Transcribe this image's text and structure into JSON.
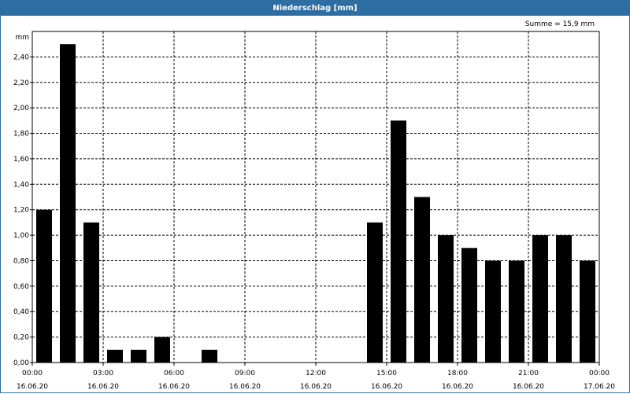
{
  "window": {
    "title": "Niederschlag [mm]"
  },
  "summary": {
    "label": "Summe = 15,9 mm"
  },
  "colors": {
    "titlebar": "#2f6ea3",
    "bar": "#000000",
    "grid": "#000000"
  },
  "chart_data": {
    "type": "bar",
    "title": "Niederschlag [mm]",
    "ylabel": "mm",
    "ylim": [
      0,
      2.6
    ],
    "grid": true,
    "y_ticks": [
      "0,00",
      "0,20",
      "0,40",
      "0,60",
      "0,80",
      "1,00",
      "1,20",
      "1,40",
      "1,60",
      "1,80",
      "2,00",
      "2,20",
      "2,40"
    ],
    "x_ticks": [
      {
        "time": "00:00",
        "date": "16.06.20"
      },
      {
        "time": "03:00",
        "date": "16.06.20"
      },
      {
        "time": "06:00",
        "date": "16.06.20"
      },
      {
        "time": "09:00",
        "date": "16.06.20"
      },
      {
        "time": "12:00",
        "date": "16.06.20"
      },
      {
        "time": "15:00",
        "date": "16.06.20"
      },
      {
        "time": "18:00",
        "date": "16.06.20"
      },
      {
        "time": "21:00",
        "date": "16.06.20"
      },
      {
        "time": "00:00",
        "date": "17.06.20"
      }
    ],
    "categories": [
      "00:00",
      "01:00",
      "02:00",
      "03:00",
      "04:00",
      "05:00",
      "06:00",
      "07:00",
      "08:00",
      "09:00",
      "10:00",
      "11:00",
      "12:00",
      "13:00",
      "14:00",
      "15:00",
      "16:00",
      "17:00",
      "18:00",
      "19:00",
      "20:00",
      "21:00",
      "22:00",
      "23:00"
    ],
    "values": [
      1.2,
      2.5,
      1.1,
      0.1,
      0.1,
      0.2,
      0.0,
      0.1,
      0.0,
      0.0,
      0.0,
      0.0,
      0.0,
      0.0,
      1.1,
      1.9,
      1.3,
      1.0,
      0.9,
      0.8,
      0.8,
      1.0,
      1.0,
      0.8
    ]
  }
}
